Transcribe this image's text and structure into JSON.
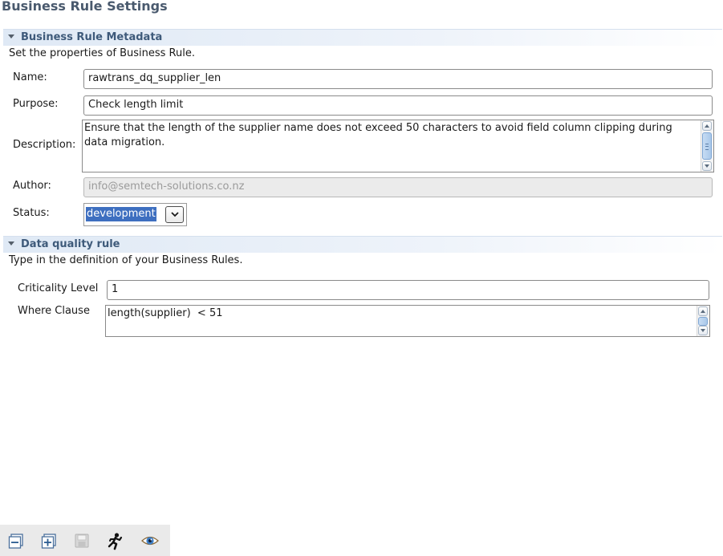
{
  "page": {
    "title": "Business Rule Settings"
  },
  "metadata_section": {
    "title": "Business Rule Metadata",
    "description": "Set the properties of Business Rule.",
    "name": {
      "label": "Name:",
      "value": "rawtrans_dq_supplier_len"
    },
    "purpose": {
      "label": "Purpose:",
      "value": "Check length limit"
    },
    "description_field": {
      "label": "Description:",
      "value": "Ensure that the length of the supplier name does not exceed 50 characters to avoid field column clipping during data migration."
    },
    "author": {
      "label": "Author:",
      "value": "info@semtech-solutions.co.nz"
    },
    "status": {
      "label": "Status:",
      "value": "development"
    }
  },
  "dq_section": {
    "title": "Data quality rule",
    "description": "Type in the definition of your Business Rules.",
    "criticality": {
      "label": "Criticality Level",
      "value": "1"
    },
    "where_clause": {
      "label": "Where Clause",
      "value": "length(supplier)  < 51"
    }
  },
  "toolbar": {
    "buttons": [
      {
        "icon": "collapse-all-icon"
      },
      {
        "icon": "expand-all-icon"
      },
      {
        "icon": "save-icon",
        "enabled": false
      },
      {
        "icon": "run-icon"
      },
      {
        "icon": "preview-eye-icon"
      }
    ]
  },
  "colors": {
    "section_title": "#3e5a7a",
    "page_title": "#4a5a6e",
    "selection": "#3e6fc0"
  }
}
